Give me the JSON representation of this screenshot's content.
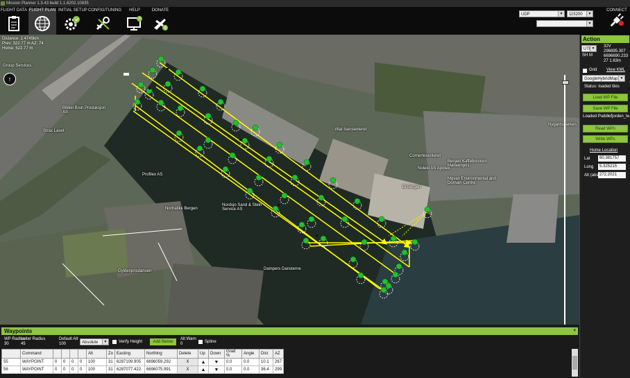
{
  "window": {
    "title": "Mission Planner 1.3.43 build 1.1.6202.10835"
  },
  "toolbar": {
    "buttons": [
      {
        "label": "FLIGHT DATA",
        "icon": "clipboard-icon"
      },
      {
        "label": "FLIGHT PLAN",
        "icon": "globe-icon"
      },
      {
        "label": "INITIAL SETUP",
        "icon": "setup-gear-icon"
      },
      {
        "label": "CONFIG/TUNING",
        "icon": "wrench-plane-icon"
      },
      {
        "label": "HELP",
        "icon": "monitor-help-icon"
      },
      {
        "label": "DONATE",
        "icon": "plane-dollar-icon"
      }
    ],
    "port": "UDP",
    "baud": "115200",
    "connect_label": "CONNECT"
  },
  "map": {
    "stats": {
      "distance": "Distance: 2.4745km",
      "prev": "Prev: 322.77 m AZ: 74",
      "home": "Home: 522.77 m"
    },
    "labels": [
      {
        "text": "Group Services"
      },
      {
        "text": "Bikkel Brun Produksjon AS"
      },
      {
        "text": "Strax Laset"
      },
      {
        "text": "Profilex AS"
      },
      {
        "text": "Nordsjo Sand & Stein Service AS"
      },
      {
        "text": "Nortrafikk Bergen"
      },
      {
        "text": "Gyldenprisdansen"
      },
      {
        "text": "Dampers Dansterne"
      },
      {
        "text": "Vital Isensenteret"
      },
      {
        "text": "Cornertesenteret"
      },
      {
        "text": "Noleid AS Apotek"
      },
      {
        "text": "Bi Bergen"
      },
      {
        "text": "Bergen Kaffebrenneri Marieenpris"
      },
      {
        "text": "Mgvan Environmental and Domain Centre"
      },
      {
        "text": "Nygardsparken"
      }
    ]
  },
  "action_panel": {
    "title": "Action",
    "coord_system": "UTM",
    "zone": "32V",
    "shim_label": "SH M",
    "easting": "296895.307",
    "northing": "6696690.233",
    "alt": "27 1.63m",
    "grid_label": "Grid",
    "view_kml": "View KML",
    "map_type": "GoogleHybridMap",
    "status": "Status: loaded tiles",
    "load_wp": "Load WP File",
    "save_wp": "Save WP File",
    "loaded_file": "Loaded Puddlefjorden_te",
    "read_wps": "Read WPs",
    "write_wps": "Write WPs",
    "home_location": "Home Location",
    "lat_label": "Lat",
    "lat": "60.381757",
    "long_label": "Long",
    "long": "5.325215",
    "alt_label": "Alt (abs)",
    "alt_abs": "272.2021"
  },
  "waypoints_panel": {
    "title": "Waypoints",
    "collapse": "×",
    "wp_radius_label": "WP Radius",
    "loiter_radius_label": "Loiter Radius",
    "default_alt_label": "Default Alt",
    "wp_radius": "30",
    "loiter_radius": "45",
    "default_alt": "100",
    "frame": "Absolute",
    "verify_height": "Verify Height",
    "add_below": "Add Below",
    "alt_warn_label": "Alt Warn",
    "alt_warn": "0",
    "spline": "Spline",
    "columns": [
      "",
      "Command",
      "",
      "",
      "",
      "",
      "Alt",
      "Zo",
      "Easting",
      "Northing",
      "Delete",
      "Up",
      "Down",
      "Grad %",
      "Angle",
      "Dist",
      "AZ"
    ],
    "rows": [
      {
        "num": "55",
        "command": "WAYPOINT",
        "p1": "0",
        "p2": "0",
        "p3": "0",
        "p4": "0",
        "alt": "100",
        "zone": "31",
        "easting": "6287109.905",
        "northing": "6696059.292",
        "delete": "X",
        "grad": "0.0",
        "angle": "0.0",
        "dist": "10.1",
        "az": "267"
      },
      {
        "num": "56",
        "command": "WAYPOINT",
        "p1": "0",
        "p2": "0",
        "p3": "0",
        "p4": "0",
        "alt": "100",
        "zone": "31",
        "easting": "6287077.422",
        "northing": "6696075.991",
        "delete": "X",
        "grad": "0.0",
        "angle": "0.0",
        "dist": "36.4",
        "az": "299"
      }
    ]
  }
}
